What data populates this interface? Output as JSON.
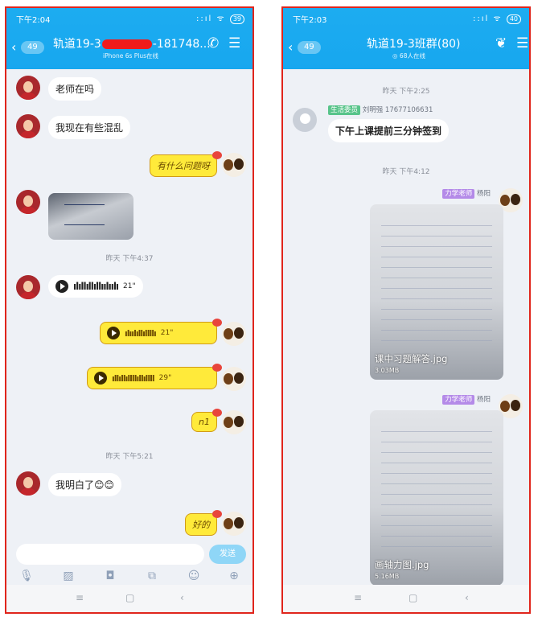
{
  "left": {
    "status": {
      "time": "下午2:04",
      "signal": "::ıl ᯤ",
      "battery": "39"
    },
    "header": {
      "back_count": "49",
      "title_part1": "轨道19-3",
      "title_part2": "-181748...",
      "subtitle": "iPhone 6s Plus在线"
    },
    "messages": {
      "m1": "老师在吗",
      "m2": "我现在有些混乱",
      "m3": "有什么问题呀",
      "ts1": "昨天 下午4:37",
      "v1_wave": "ılıllıllıllıılıılı",
      "v1_dur": "21\"",
      "v2_wave": "ılıılıllıllllı",
      "v2_dur": "21\"",
      "v3_wave": "ıllıllıllllıllıllll",
      "v3_dur": "29\"",
      "m4": "n1",
      "ts2": "昨天 下午5:21",
      "m5": "我明白了😊😊",
      "m6": "好的"
    },
    "input": {
      "send_label": "发送"
    }
  },
  "right": {
    "status": {
      "time": "下午2:03",
      "signal": "::ıl ᯤ",
      "battery": "40"
    },
    "header": {
      "back_count": "49",
      "title": "轨道19-3班群(80)",
      "subtitle": "◎ 68人在线"
    },
    "ts1": "昨天 下午2:25",
    "msg1": {
      "tag": "生活委员",
      "sender": "刘明强 17677106631",
      "text": "下午上课提前三分钟签到"
    },
    "ts2": "昨天 下午4:12",
    "file1": {
      "tag": "力学老师",
      "sender": "杨阳",
      "name": "课中习题解答.jpg",
      "size": "3.03MB"
    },
    "file2": {
      "tag": "力学老师",
      "sender": "杨阳",
      "name": "画轴力图.jpg",
      "size": "5.16MB"
    }
  },
  "icons": {
    "mic": "🎙",
    "picture": "▨",
    "camera": "◘",
    "gift": "⧉",
    "emoji": "☺",
    "plus": "⊕",
    "menu": "≡",
    "home": "▢",
    "back": "‹",
    "phone": "✆",
    "hamburger": "☰",
    "leaf": "❦"
  }
}
